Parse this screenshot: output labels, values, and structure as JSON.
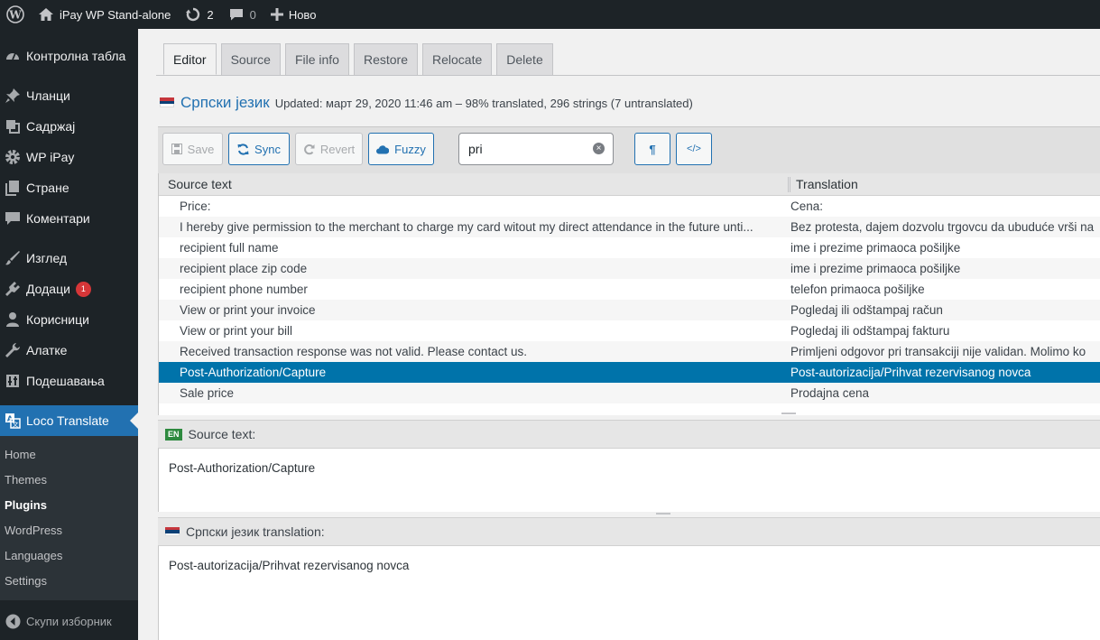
{
  "adminbar": {
    "site_name": "iPay WP Stand-alone",
    "updates_count": "2",
    "comments_count": "0",
    "new_label": "Ново"
  },
  "sidebar": {
    "items": [
      {
        "label": "Контролна табла",
        "icon": "dashboard-icon"
      },
      {
        "label": "Чланци",
        "icon": "pin-icon"
      },
      {
        "label": "Садржај",
        "icon": "media-icon"
      },
      {
        "label": "WP iPay",
        "icon": "gear-icon"
      },
      {
        "label": "Стране",
        "icon": "pages-icon"
      },
      {
        "label": "Коментари",
        "icon": "comment-icon"
      },
      {
        "label": "Изглед",
        "icon": "brush-icon"
      },
      {
        "label": "Додаци",
        "icon": "plugin-icon",
        "badge": "1"
      },
      {
        "label": "Корисници",
        "icon": "users-icon"
      },
      {
        "label": "Алатке",
        "icon": "wrench-icon"
      },
      {
        "label": "Подешавања",
        "icon": "settings-icon"
      },
      {
        "label": "Loco Translate",
        "icon": "translate-icon"
      }
    ],
    "submenu": [
      "Home",
      "Themes",
      "Plugins",
      "WordPress",
      "Languages",
      "Settings"
    ],
    "collapse_label": "Скупи изборник"
  },
  "tabs": [
    "Editor",
    "Source",
    "File info",
    "Restore",
    "Relocate",
    "Delete"
  ],
  "locale": {
    "name": "Српски језик",
    "status": "Updated: март 29, 2020 11:46 am – 98% translated, 296 strings (7 untranslated)"
  },
  "toolbar": {
    "save": "Save",
    "sync": "Sync",
    "revert": "Revert",
    "fuzzy": "Fuzzy",
    "search_value": "pri",
    "pilcrow": "¶",
    "code": "</>"
  },
  "grid": {
    "col_source": "Source text",
    "col_translation": "Translation",
    "rows": [
      {
        "source": "Price:",
        "translation": "Cena:"
      },
      {
        "source": "I hereby give permission to the merchant to charge my card witout my direct attendance in the future unti...",
        "translation": "Bez protesta, dajem dozvolu trgovcu da ubuduće vrši na"
      },
      {
        "source": "recipient full name",
        "translation": "ime i prezime primaoca pošiljke"
      },
      {
        "source": "recipient place zip code",
        "translation": "ime i prezime primaoca pošiljke"
      },
      {
        "source": "recipient phone number",
        "translation": "telefon primaoca pošiljke"
      },
      {
        "source": "View or print your invoice",
        "translation": "Pogledaj ili odštampaj račun"
      },
      {
        "source": "View or print your bill",
        "translation": "Pogledaj ili odštampaj fakturu"
      },
      {
        "source": "Received transaction response was not valid. Please contact us.",
        "translation": "Primljeni odgovor pri transakciji nije validan. Molimo ko"
      },
      {
        "source": "Post-Authorization/Capture",
        "translation": "Post-autorizacija/Prihvat rezervisanog novca",
        "selected": true
      },
      {
        "source": "Sale price",
        "translation": "Prodajna cena"
      }
    ]
  },
  "source_pane": {
    "badge": "EN",
    "title": "Source text:",
    "text": "Post-Authorization/Capture"
  },
  "translation_pane": {
    "title": "Српски језик translation:",
    "text": "Post-autorizacija/Prihvat rezervisanog novca"
  },
  "colors": {
    "adminbar_bg": "#1d2327",
    "accent": "#2271b1",
    "selected_row": "#0073aa",
    "badge": "#d63638"
  }
}
